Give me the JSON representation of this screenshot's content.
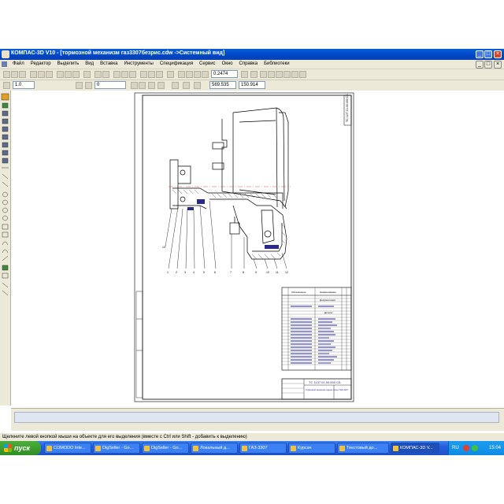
{
  "window": {
    "title": "КОМПАС-3D V10 - [тормозной механизм газ3307безрис.cdw ->Системный вид]",
    "buttons": [
      "minimize",
      "maximize",
      "close"
    ]
  },
  "menu": {
    "items": [
      "Файл",
      "Редактор",
      "Выделить",
      "Вид",
      "Вставка",
      "Инструменты",
      "Спецификация",
      "Сервис",
      "Окно",
      "Справка",
      "Библиотеки"
    ]
  },
  "toolbar": {
    "zoom_value": "0.2474",
    "line_scale": "1.0",
    "layer_value": "0",
    "coord_x": "569.535",
    "coord_y": "150.914"
  },
  "drawing": {
    "stamp_code": "ТС 1137.01.00.000 СБ",
    "stamp_title": "Тормозной механизм задних колес ГАЗ-3307",
    "spec_header": [
      "Обозначение",
      "Наименование"
    ],
    "spec_section_docs": "Документация",
    "spec_section_parts": "Детали",
    "side_stamp": "ТС 1137.01.00.000 СБ",
    "leaders": [
      "1",
      "2",
      "3",
      "4",
      "5",
      "6",
      "7",
      "8",
      "9",
      "10",
      "11",
      "12",
      "13"
    ]
  },
  "status": {
    "text": "Щелкните левой кнопкой мыши на объекте для его выделения (вместе с Ctrl или Shift - добавить к выделению)"
  },
  "taskbar": {
    "start_label": "пуск",
    "tasks": [
      "COMODO Inte...",
      "DigSeller - Go...",
      "DigSeller - Go...",
      "Локальный д...",
      "ГАЗ-3307",
      "Курсач",
      "Текстовый до...",
      "КОМПАС-3D V..."
    ],
    "lang": "RU",
    "clock": "15:04"
  }
}
